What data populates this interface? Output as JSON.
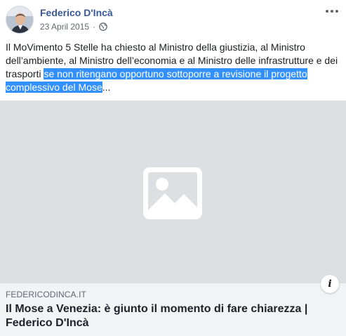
{
  "post": {
    "author": "Federico D'Incà",
    "date": "23 April 2015",
    "separator": "·",
    "privacy_icon": "globe-icon",
    "more_icon": "more-options-icon",
    "text_plain": "Il MoVimento 5 Stelle ha chiesto al Ministro della giustizia, al Ministro dell’ambiente, al Ministro dell’economia e al Ministro delle infrastrutture e dei trasporti ",
    "text_highlighted": "se non ritengano opportuno sottoporre a revisione il progetto complessivo del Mose",
    "text_ellipsis": "..."
  },
  "link_preview": {
    "image_icon": "image-placeholder-icon",
    "domain": "FEDERICODINCA.IT",
    "title": "Il Mose a Venezia: è giunto il momento di fare chiarezza | Federico D'Incà",
    "info_label": "i"
  },
  "colors": {
    "author": "#385898",
    "highlight": "#3390ff",
    "preview_bg": "#dddfe2",
    "footer_bg": "#f2f3f5"
  }
}
